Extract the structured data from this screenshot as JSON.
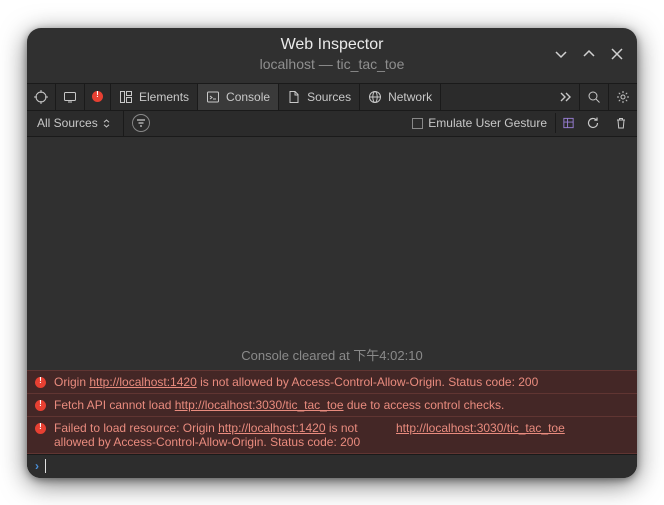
{
  "window": {
    "title": "Web Inspector",
    "subtitle": "localhost — tic_tac_toe"
  },
  "tabs": {
    "elements": "Elements",
    "console": "Console",
    "sources": "Sources",
    "network": "Network"
  },
  "filter": {
    "source_dropdown": "All Sources",
    "emulate_label": "Emulate User Gesture"
  },
  "clear_message": "Console cleared at 下午4:02:10",
  "errors": [
    {
      "prefix": "Origin ",
      "link": "http://localhost:1420",
      "suffix": " is not allowed by Access-Control-Allow-Origin. Status code: 200"
    },
    {
      "prefix": "Fetch API cannot load ",
      "link": "http://localhost:3030/tic_tac_toe",
      "suffix": " due to access control checks."
    },
    {
      "prefix": "Failed to load resource: Origin ",
      "link": "http://localhost:1420",
      "suffix": " is not allowed by Access-Control-Allow-Origin. Status code: 200",
      "source": "http://localhost:3030/tic_tac_toe"
    }
  ],
  "icons": {
    "element_picker": "element-picker",
    "device": "device",
    "error_badge": "error-badge"
  }
}
